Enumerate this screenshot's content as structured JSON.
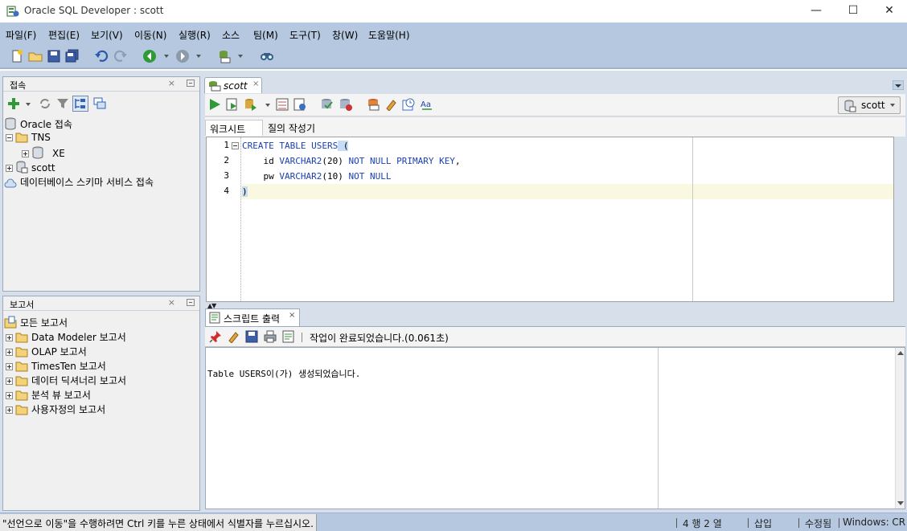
{
  "window": {
    "title": "Oracle SQL Developer : scott",
    "minimize": "—",
    "maximize": "☐",
    "close": "✕"
  },
  "menu": [
    {
      "label": "파일(F)"
    },
    {
      "label": "편집(E)"
    },
    {
      "label": "보기(V)"
    },
    {
      "label": "이동(N)"
    },
    {
      "label": "실행(R)"
    },
    {
      "label": "소스"
    },
    {
      "label": "팀(M)"
    },
    {
      "label": "도구(T)"
    },
    {
      "label": "창(W)"
    },
    {
      "label": "도움말(H)"
    }
  ],
  "connections_panel": {
    "title": "접속",
    "close": "×",
    "tree": [
      {
        "label": "Oracle 접속"
      },
      {
        "label": "TNS"
      },
      {
        "label": "XE"
      },
      {
        "label": "scott"
      },
      {
        "label": "데이터베이스 스키마 서비스 접속"
      }
    ]
  },
  "reports_panel": {
    "title": "보고서",
    "close": "×",
    "tree": [
      {
        "label": "모든 보고서"
      },
      {
        "label": "Data Modeler 보고서"
      },
      {
        "label": "OLAP 보고서"
      },
      {
        "label": "TimesTen 보고서"
      },
      {
        "label": "데이터 딕셔너리 보고서"
      },
      {
        "label": "분석 뷰 보고서"
      },
      {
        "label": "사용자정의 보고서"
      }
    ]
  },
  "editor": {
    "tab_label": "scott",
    "tab_close": "×",
    "connection": "scott",
    "subtabs": [
      "워크시트",
      "질의 작성기"
    ],
    "line_numbers": [
      "1",
      "2",
      "3",
      "4"
    ],
    "lines": [
      {
        "kw1": "CREATE TABLE USERS",
        "rest": " ("
      },
      {
        "ident": "    id",
        "kw1": " VARCHAR2",
        "rest": "(20)",
        "kw2": " NOT NULL PRIMARY KEY",
        "tail": ","
      },
      {
        "ident": "    pw",
        "kw1": " VARCHAR2",
        "rest": "(10)",
        "kw2": " NOT NULL"
      },
      {
        "rest": ")"
      }
    ]
  },
  "output": {
    "tab_label": "스크립트 출력",
    "tab_close": "×",
    "status": "작업이 완료되었습니다.(0.061초)",
    "text": "Table USERS이(가) 생성되었습니다."
  },
  "statusbar": {
    "message": "\"선언으로 이동\"을 수행하려면 Ctrl 키를 누른 상태에서 식별자를 누르십시오.",
    "position": "4 행 2 열",
    "mode": "삽입",
    "state": "수정됨",
    "eol": "Windows: CR"
  },
  "colors": {
    "chrome": "#b5c8df",
    "keyword": "#1a3fb0",
    "current_line": "#fbf8e1"
  }
}
